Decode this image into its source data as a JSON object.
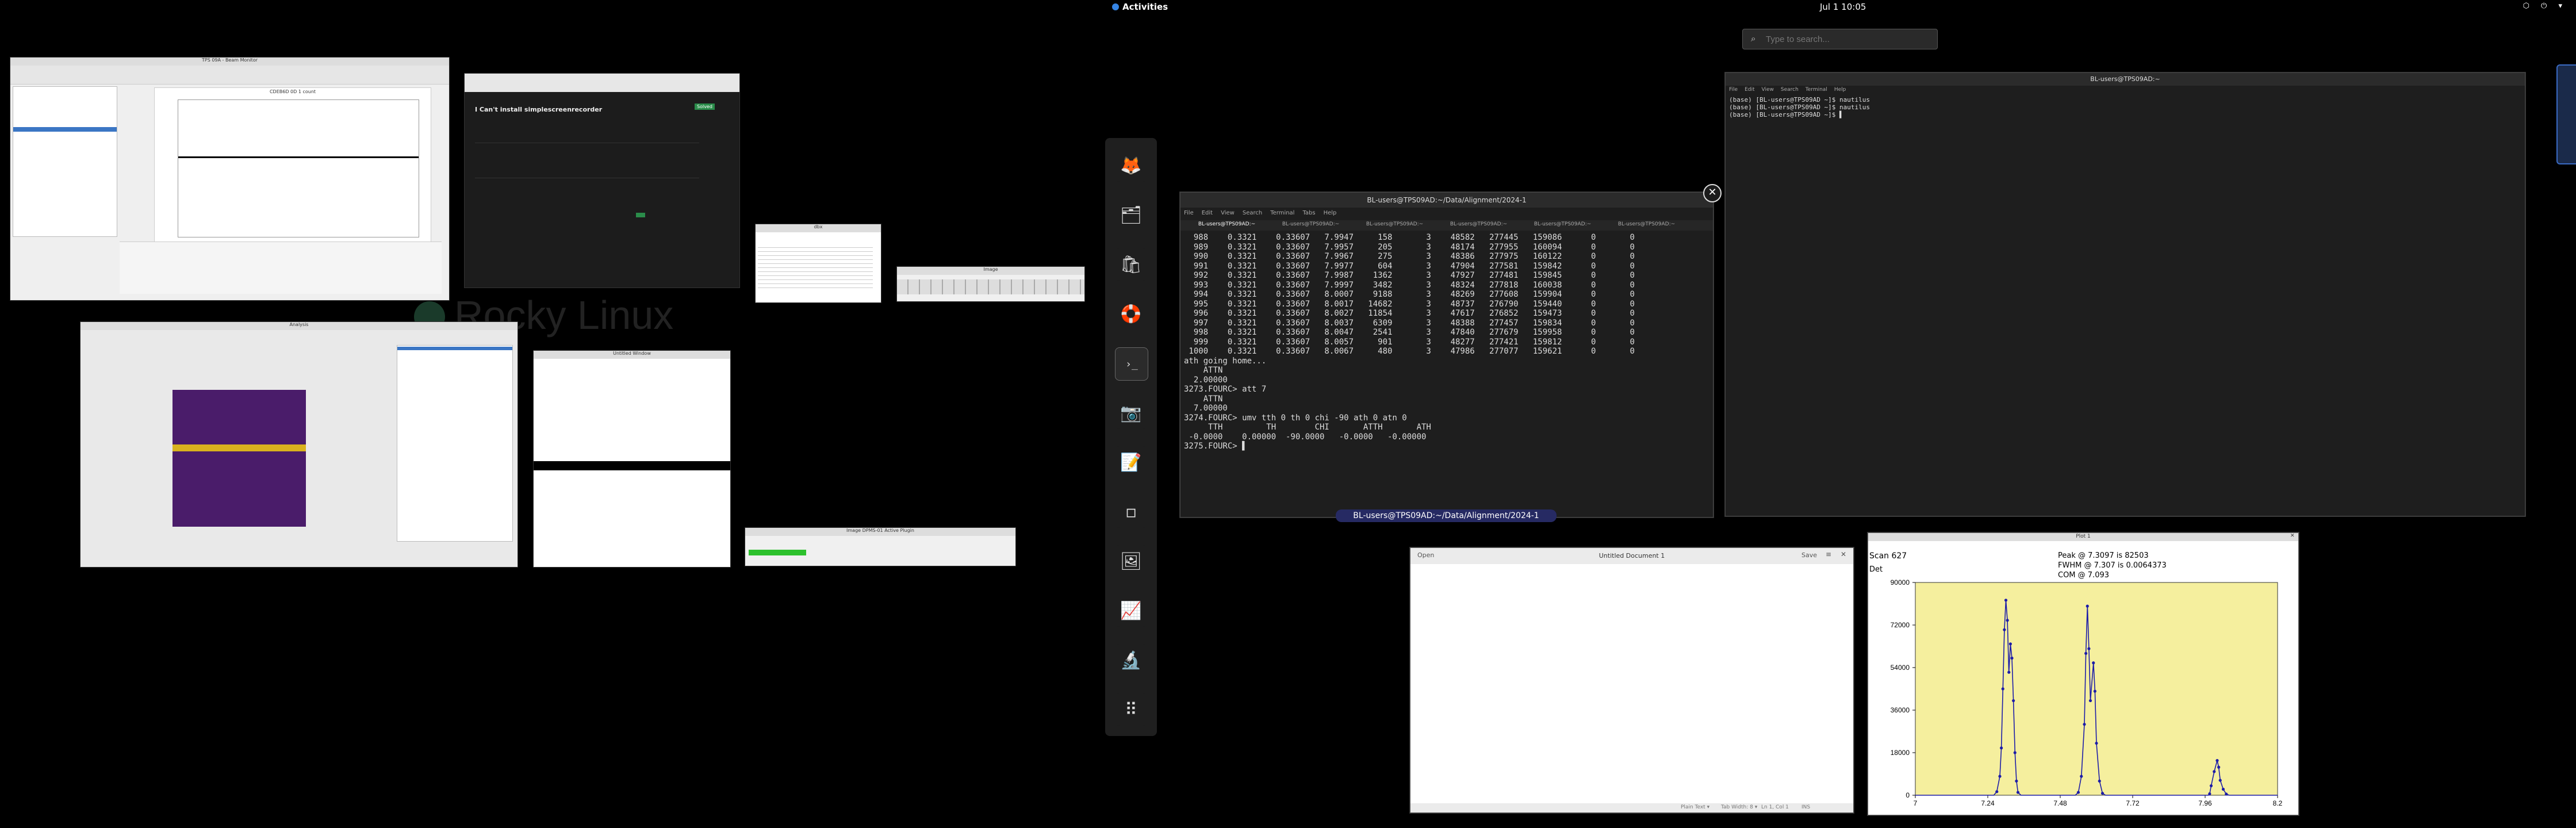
{
  "topbar": {
    "activities": "Activities",
    "clock": "Jul 1  10:05",
    "system_icons": "⬡ ⏻ ▾"
  },
  "search": {
    "placeholder": "Type to search..."
  },
  "desktop": {
    "wallpaper_text": "Rocky Linux"
  },
  "dock": {
    "apps": [
      {
        "name": "firefox-icon",
        "glyph": "🦊",
        "bg": "#1f1f1f"
      },
      {
        "name": "files-icon",
        "glyph": "🗂",
        "bg": "#1f1f1f"
      },
      {
        "name": "software-icon",
        "glyph": "🛍",
        "bg": "#1f1f1f"
      },
      {
        "name": "help-icon",
        "glyph": "🛟",
        "bg": "#1f1f1f"
      },
      {
        "name": "terminal-icon",
        "glyph": "›_",
        "bg": "#1f1f1f"
      },
      {
        "name": "screenshot-icon",
        "glyph": "📷",
        "bg": "#1f1f1f"
      },
      {
        "name": "text-editor-icon",
        "glyph": "📝",
        "bg": "#1f1f1f"
      },
      {
        "name": "blank-app-icon",
        "glyph": "▫",
        "bg": "#1f1f1f"
      },
      {
        "name": "image-app-icon",
        "glyph": "🖼",
        "bg": "#1f1f1f"
      },
      {
        "name": "chart-app-icon",
        "glyph": "📈",
        "bg": "#1f1f1f"
      },
      {
        "name": "microscope-icon",
        "glyph": "🔬",
        "bg": "#1f1f1f"
      },
      {
        "name": "app-grid-icon",
        "glyph": "⠿",
        "bg": "#1f1f1f"
      }
    ]
  },
  "spec_terminal": {
    "title": "BL-users@TPS09AD:~/Data/Alignment/2024-1",
    "tabs": [
      "BL-users@TPS09AD:~",
      "BL-users@TPS09AD:~",
      "BL-users@TPS09AD:~",
      "BL-users@TPS09AD:~",
      "BL-users@TPS09AD:~",
      "BL-users@TPS09AD:~"
    ],
    "menu": [
      "File",
      "Edit",
      "View",
      "Search",
      "Terminal",
      "Tabs",
      "Help"
    ],
    "lines": [
      "  988    0.3321    0.33607   7.9947     158       3    48582   277445   159086      0       0",
      "  989    0.3321    0.33607   7.9957     205       3    48174   277955   160094      0       0",
      "  990    0.3321    0.33607   7.9967     275       3    48386   277975   160122      0       0",
      "  991    0.3321    0.33607   7.9977     604       3    47904   277581   159842      0       0",
      "  992    0.3321    0.33607   7.9987    1362       3    47927   277481   159845      0       0",
      "  993    0.3321    0.33607   7.9997    3482       3    48324   277818   160038      0       0",
      "  994    0.3321    0.33607   8.0007    9188       3    48269   277608   159904      0       0",
      "  995    0.3321    0.33607   8.0017   14682       3    48737   276790   159440      0       0",
      "  996    0.3321    0.33607   8.0027   11854       3    47617   276852   159473      0       0",
      "  997    0.3321    0.33607   8.0037    6309       3    48388   277457   159834      0       0",
      "  998    0.3321    0.33607   8.0047    2541       3    47840   277679   159958      0       0",
      "  999    0.3321    0.33607   8.0057     901       3    48277   277421   159812      0       0",
      " 1000    0.3321    0.33607   8.0067     480       3    47986   277077   159621      0       0",
      "ath going home...",
      "",
      "    ATTN",
      "  2.00000",
      "",
      "3273.FOURC> att 7",
      "",
      "    ATTN",
      "  7.00000",
      "",
      "3274.FOURC> umv tth 0 th 0 chi -90 ath 0 atn 0",
      "",
      "     TTH         TH        CHI       ATTH       ATH",
      " -0.0000    0.00000  -90.0000   -0.0000   -0.00000",
      "",
      "3275.FOURC> ▌"
    ],
    "caption": "BL-users@TPS09AD:~/Data/Alignment/2024-1"
  },
  "right_terminal": {
    "title": "BL-users@TPS09AD:~",
    "menu": [
      "File",
      "Edit",
      "View",
      "Search",
      "Terminal",
      "Help"
    ],
    "lines": [
      "(base) [BL-users@TPS09AD ~]$ nautilus",
      "(base) [BL-users@TPS09AD ~]$ nautilus",
      "(base) [BL-users@TPS09AD ~]$ ▌"
    ]
  },
  "editor": {
    "title": "Untitled Document 1",
    "open_label": "Open",
    "save_label": "Save",
    "status": [
      "Plain Text ▾",
      "Tab Width: 8 ▾",
      "Ln 1, Col 1",
      "INS"
    ]
  },
  "scan_plot": {
    "title": "Plot 1",
    "scan_label": "Scan 627",
    "ylabel": "Det",
    "peak": "Peak @ 7.3097 is 82503",
    "fwhm": "FWHM @ 7.307 is 0.0064373",
    "com": "COM @ 7.093"
  },
  "chart_data": {
    "type": "line",
    "title": "",
    "xlabel": "",
    "ylabel": "Det",
    "xlim": [
      7.0,
      8.2
    ],
    "ylim": [
      0,
      90000
    ],
    "x_ticks": [
      "7",
      "7.24",
      "7.48",
      "7.72",
      "7.96",
      "8.2"
    ],
    "y_ticks": [
      "0",
      "18000",
      "36000",
      "54000",
      "72000",
      "90000"
    ],
    "series": [
      {
        "points": [
          [
            7.0,
            0
          ],
          [
            7.26,
            0
          ],
          [
            7.27,
            1500
          ],
          [
            7.28,
            8000
          ],
          [
            7.285,
            20000
          ],
          [
            7.29,
            45000
          ],
          [
            7.295,
            70000
          ],
          [
            7.3,
            82503
          ],
          [
            7.305,
            74000
          ],
          [
            7.31,
            52000
          ],
          [
            7.315,
            64000
          ],
          [
            7.32,
            58000
          ],
          [
            7.325,
            40000
          ],
          [
            7.33,
            18000
          ],
          [
            7.335,
            6000
          ],
          [
            7.34,
            1200
          ],
          [
            7.35,
            0
          ],
          [
            7.53,
            0
          ],
          [
            7.54,
            1200
          ],
          [
            7.55,
            8000
          ],
          [
            7.56,
            30000
          ],
          [
            7.565,
            60000
          ],
          [
            7.57,
            80000
          ],
          [
            7.575,
            62000
          ],
          [
            7.58,
            40000
          ],
          [
            7.59,
            56000
          ],
          [
            7.595,
            44000
          ],
          [
            7.6,
            22000
          ],
          [
            7.61,
            6000
          ],
          [
            7.62,
            800
          ],
          [
            7.63,
            0
          ],
          [
            7.97,
            0
          ],
          [
            7.975,
            600
          ],
          [
            7.98,
            4000
          ],
          [
            7.99,
            10000
          ],
          [
            8.0,
            14682
          ],
          [
            8.005,
            11854
          ],
          [
            8.01,
            6309
          ],
          [
            8.02,
            2541
          ],
          [
            8.03,
            480
          ],
          [
            8.04,
            0
          ],
          [
            8.2,
            0
          ]
        ]
      }
    ]
  },
  "thumb_windows": {
    "w1_title": "TPS 09A - Beam Monitor",
    "w1_plot_title": "CDEB6D 0D 1 count",
    "w2_title": "I Can't install simplescreenrecorder",
    "w2_tag": "Solved",
    "w3_title": "dbx",
    "w4_title": "Image",
    "w5_title": "Image DPMS-01 Active Plugin",
    "w6_title": "Untitled Window",
    "w7_title": "Analysis"
  }
}
